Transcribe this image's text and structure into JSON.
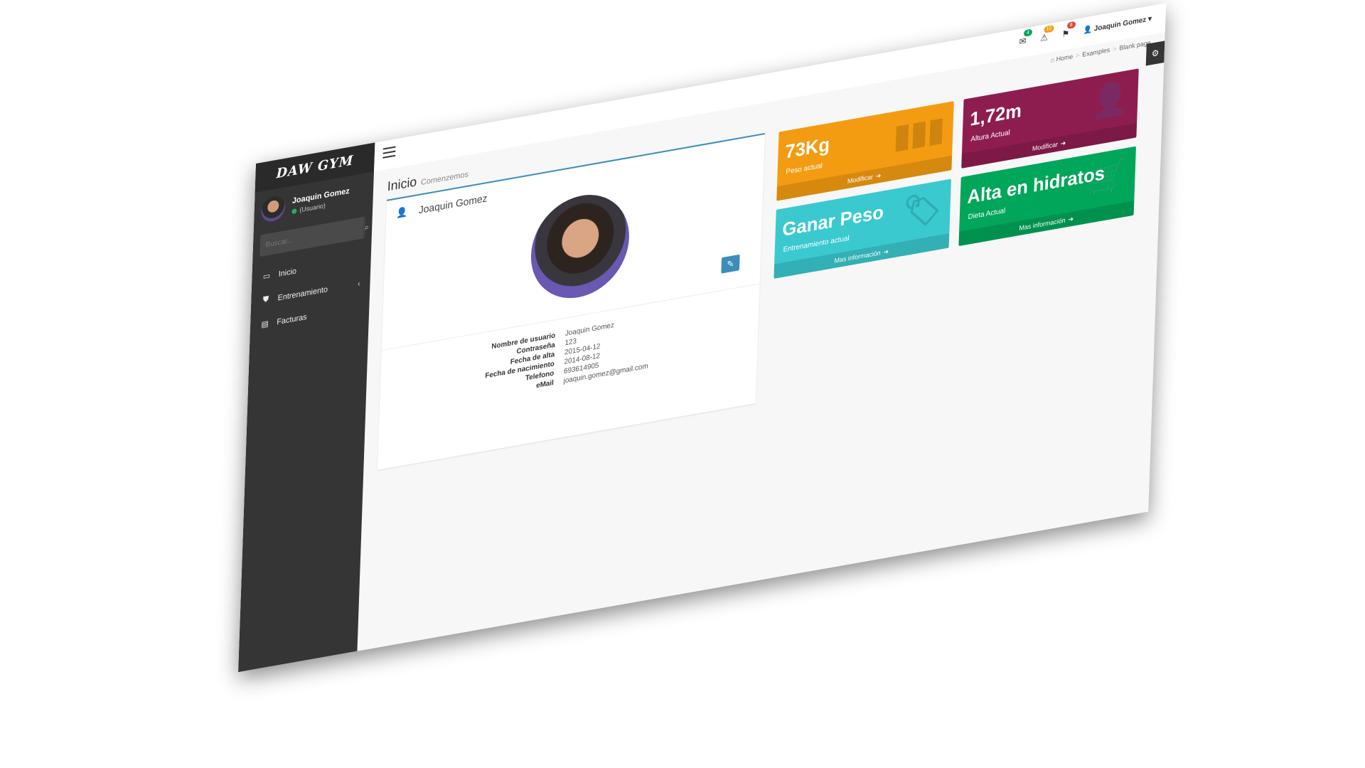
{
  "app": {
    "logo": "DAW GYM"
  },
  "sidebar": {
    "user_name": "Joaquin Gomez",
    "user_role": "(Usuario)",
    "search_placeholder": "Buscar...",
    "items": [
      {
        "label": "Inicio",
        "icon": "laptop-icon"
      },
      {
        "label": "Entrenamiento",
        "icon": "shield-icon"
      },
      {
        "label": "Facturas",
        "icon": "document-icon"
      }
    ]
  },
  "topbar": {
    "notifications": [
      {
        "icon": "envelope-icon",
        "badge": "4",
        "color": "#00a65a"
      },
      {
        "icon": "bell-icon",
        "badge": "10",
        "color": "#f39c12"
      },
      {
        "icon": "flag-icon",
        "badge": "9",
        "color": "#dd4b39"
      }
    ],
    "user_menu": "Joaquin Gomez"
  },
  "header": {
    "title": "Inicio",
    "subtitle": "Comenzemos",
    "breadcrumb": [
      "Home",
      "Examples",
      "Blank page"
    ]
  },
  "profile": {
    "name": "Joaquin Gomez",
    "fields": [
      {
        "label": "Nombre de usuario",
        "value": "Joaquin Gomez"
      },
      {
        "label": "Contraseña",
        "value": "123"
      },
      {
        "label": "Fecha de alta",
        "value": "2015-04-12"
      },
      {
        "label": "Fecha de nacimiento",
        "value": "2014-08-12"
      },
      {
        "label": "Telefono",
        "value": "693614905"
      },
      {
        "label": "eMail",
        "value": "joaquin.gomez@gmail.com"
      }
    ]
  },
  "tiles": [
    {
      "value": "73Kg",
      "label": "Peso actual",
      "footer": "Modificar",
      "color": "#f39c12"
    },
    {
      "value": "1,72m",
      "label": "Altura Actual",
      "footer": "Modificar",
      "color": "#8e1d4f"
    },
    {
      "value": "Ganar Peso",
      "label": "Entrenamiento actual",
      "footer": "Mas información",
      "color": "#3ac9cf"
    },
    {
      "value": "Alta en hidratos",
      "label": "Dieta Actual",
      "footer": "Mas información",
      "color": "#00a65a"
    }
  ]
}
